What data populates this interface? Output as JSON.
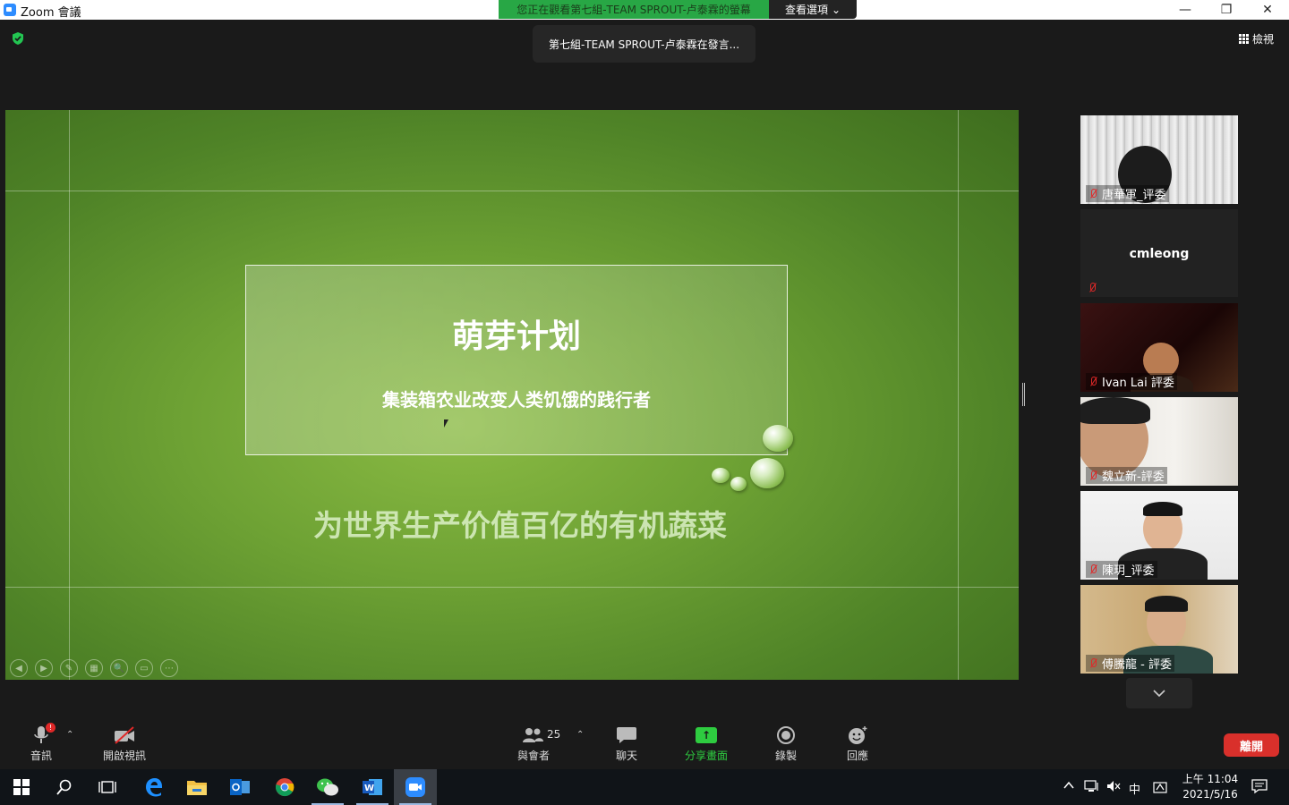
{
  "window": {
    "title": "Zoom 會議",
    "minimize": "—",
    "restore": "❐",
    "close": "✕"
  },
  "share_banner": {
    "text": "您正在觀看第七組-TEAM SPROUT-卢泰霖的螢幕",
    "view_options": "查看選項",
    "view_options_caret": "⌄"
  },
  "speaker": {
    "text": "第七組-TEAM SPROUT-卢泰霖在發言..."
  },
  "view_button": {
    "label": "檢視"
  },
  "slide": {
    "title": "萌芽计划",
    "subtitle": "集装箱农业改变人类饥饿的践行者",
    "slogan": "为世界生产价值百亿的有机蔬菜",
    "controls": [
      "◀",
      "▶",
      "✎",
      "▦",
      "🔍",
      "▭",
      "⋯"
    ]
  },
  "participants": [
    {
      "name": "唐華軍_评委",
      "muted": true
    },
    {
      "name": "cmleong",
      "muted": true
    },
    {
      "name": "Ivan Lai 評委",
      "muted": true
    },
    {
      "name": "魏立新-評委",
      "muted": true
    },
    {
      "name": "陳玥_评委",
      "muted": true
    },
    {
      "name": "傅騰龍 - 評委",
      "muted": true
    }
  ],
  "toolbar": {
    "audio_label": "音訊",
    "audio_alert": "!",
    "video_label": "開啟視訊",
    "participants_label": "與會者",
    "participants_count": "25",
    "chat_label": "聊天",
    "share_label": "分享畫面",
    "record_label": "錄製",
    "reactions_label": "回應",
    "leave_label": "離開",
    "caret": "⌃"
  },
  "taskbar": {
    "tray": {
      "ime": "中"
    },
    "clock": {
      "time": "上午 11:04",
      "date": "2021/5/16"
    }
  },
  "colors": {
    "accent_green": "#2ecc40",
    "leave_red": "#d9302b",
    "banner_green": "#28a745",
    "zoom_blue": "#2d8cff"
  }
}
